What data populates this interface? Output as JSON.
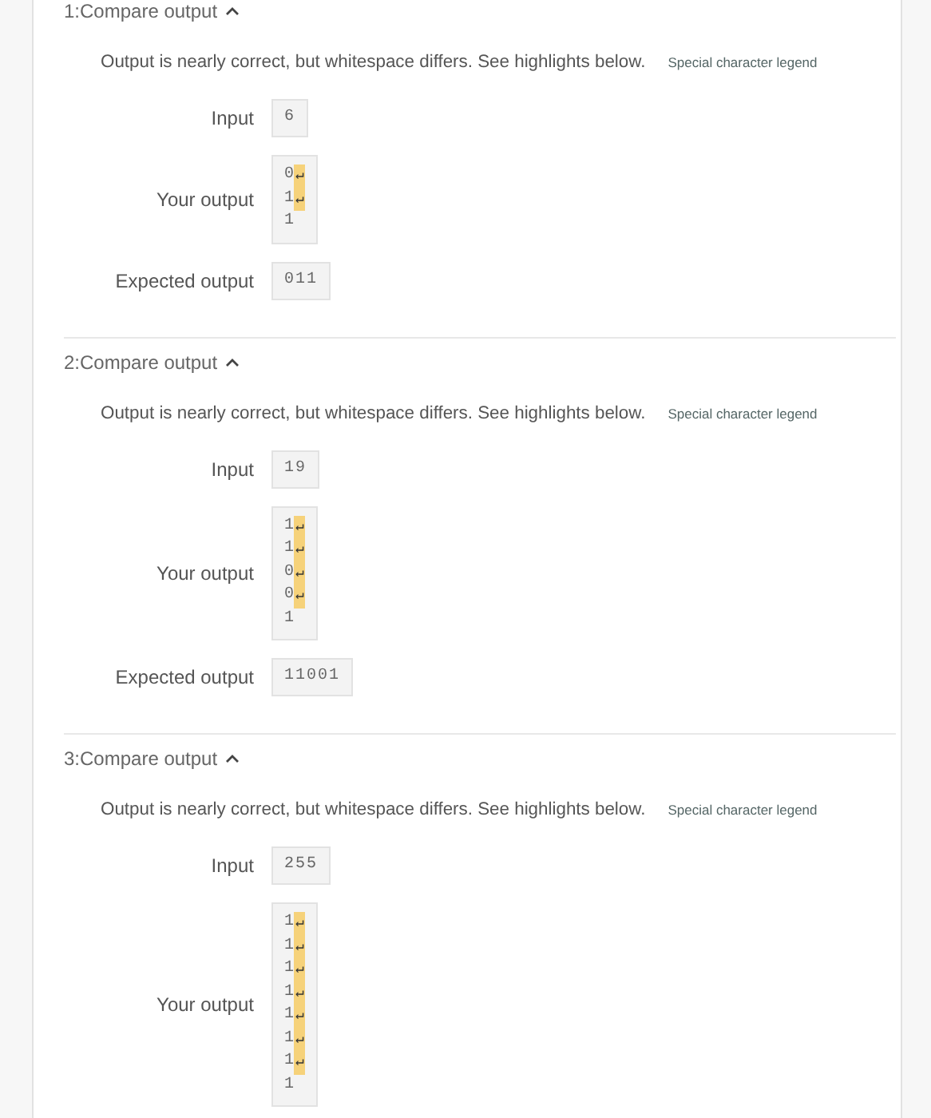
{
  "sections": [
    {
      "title": "1:Compare output",
      "expanded": true,
      "message": "Output is nearly correct, but whitespace differs. See highlights below.",
      "legend_link": "Special character legend",
      "input_label": "Input",
      "input": "6",
      "your_output_label": "Your output",
      "your_output": [
        {
          "text": "0",
          "end": "↵"
        },
        {
          "text": "1",
          "end": "↵"
        },
        {
          "text": "1"
        }
      ],
      "expected_label": "Expected output",
      "expected": "011"
    },
    {
      "title": "2:Compare output",
      "expanded": true,
      "message": "Output is nearly correct, but whitespace differs. See highlights below.",
      "legend_link": "Special character legend",
      "input_label": "Input",
      "input": "19",
      "your_output_label": "Your output",
      "your_output": [
        {
          "text": "1",
          "end": "↵"
        },
        {
          "text": "1",
          "end": "↵"
        },
        {
          "text": "0",
          "end": "↵"
        },
        {
          "text": "0",
          "end": "↵"
        },
        {
          "text": "1"
        }
      ],
      "expected_label": "Expected output",
      "expected": "11001"
    },
    {
      "title": "3:Compare output",
      "expanded": true,
      "message": "Output is nearly correct, but whitespace differs. See highlights below.",
      "legend_link": "Special character legend",
      "input_label": "Input",
      "input": "255",
      "your_output_label": "Your output",
      "your_output": [
        {
          "text": "1",
          "end": "↵"
        },
        {
          "text": "1",
          "end": "↵"
        },
        {
          "text": "1",
          "end": "↵"
        },
        {
          "text": "1",
          "end": "↵"
        },
        {
          "text": "1",
          "end": "↵"
        },
        {
          "text": "1",
          "end": "↵"
        },
        {
          "text": "1",
          "end": "↵"
        },
        {
          "text": "1"
        }
      ]
    }
  ]
}
